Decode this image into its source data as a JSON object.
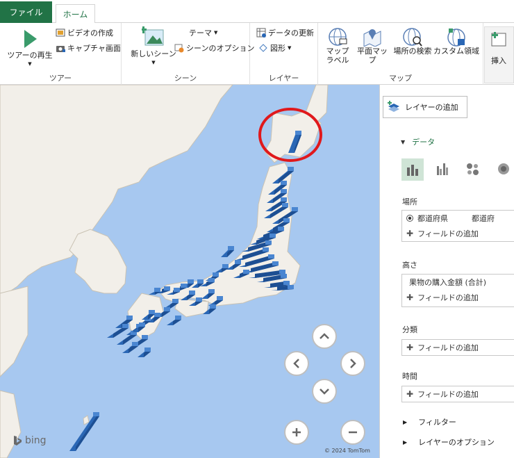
{
  "tabs": {
    "file": "ファイル",
    "home": "ホーム"
  },
  "ribbon": {
    "tour": {
      "play": "ツアーの再生",
      "video": "ビデオの作成",
      "capture": "キャプチャ画面",
      "group": "ツアー"
    },
    "scene": {
      "theme": "テーマ",
      "new_scene": "新しいシーン",
      "options": "シーンのオプション",
      "group": "シーン"
    },
    "layer": {
      "refresh": "データの更新",
      "shape": "図形",
      "group": "レイヤー"
    },
    "map": {
      "labels_l1": "マップ",
      "labels_l2": "ラベル",
      "flat": "平面マップ",
      "find": "場所の検索",
      "custom": "カスタム領域",
      "group": "マップ"
    },
    "insert": {
      "label": "挿入"
    }
  },
  "map": {
    "attribution": "© 2024 TomTom",
    "bing": "bing",
    "accent": "#e0191c",
    "bar_color": "#2a67b5"
  },
  "panel": {
    "add_layer": "レイヤーの追加",
    "data_header": "データ",
    "location": {
      "title": "場所",
      "field": "都道府県",
      "field_type": "都道府",
      "add": "フィールドの追加"
    },
    "height": {
      "title": "高さ",
      "field": "果物の購入金額 (合計)",
      "add": "フィールドの追加"
    },
    "category": {
      "title": "分類",
      "add": "フィールドの追加"
    },
    "time": {
      "title": "時間",
      "add": "フィールドの追加"
    },
    "filter": "フィルター",
    "layer_options": "レイヤーのオプション"
  }
}
